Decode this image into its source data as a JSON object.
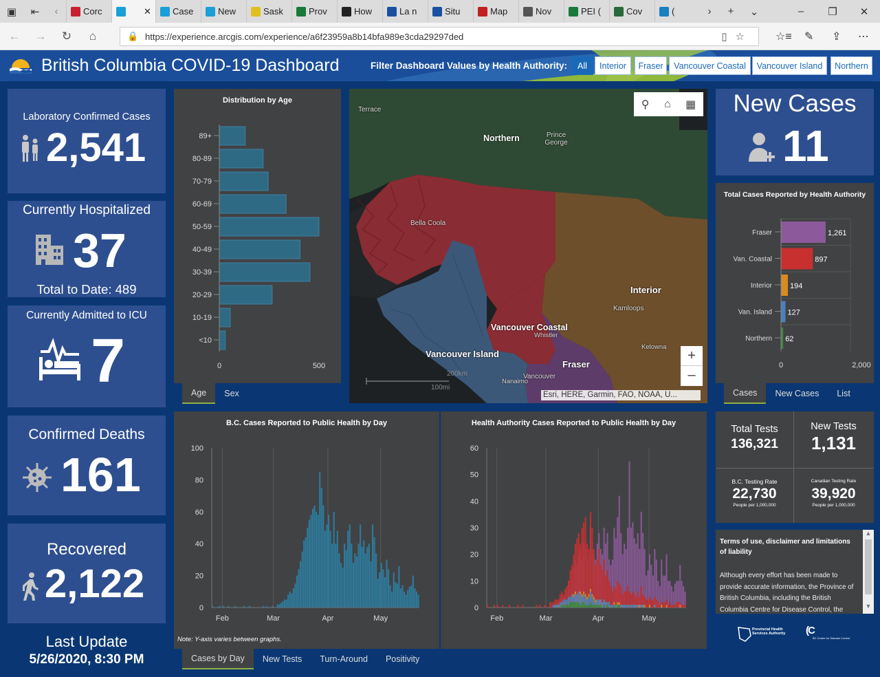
{
  "browser": {
    "tabs": [
      {
        "label": "Corc",
        "color": "#c8202e"
      },
      {
        "label": "",
        "color": "#1a9fd6",
        "active": true
      },
      {
        "label": "Case",
        "color": "#1a9fd6"
      },
      {
        "label": "New",
        "color": "#1a9fd6"
      },
      {
        "label": "Sask",
        "color": "#e0c020"
      },
      {
        "label": "Prov",
        "color": "#1a7a3a"
      },
      {
        "label": "How",
        "color": "#222222"
      },
      {
        "label": "La n",
        "color": "#1a50a0"
      },
      {
        "label": "Situ",
        "color": "#1a50a0"
      },
      {
        "label": "Map",
        "color": "#c02020"
      },
      {
        "label": "Nov",
        "color": "#555555"
      },
      {
        "label": "PEI (",
        "color": "#1a7a3a"
      },
      {
        "label": "Cov",
        "color": "#2a6a3a"
      },
      {
        "label": "(",
        "color": "#1a80c0"
      }
    ],
    "url": "https://experience.arcgis.com/experience/a6f23959a8b14bfa989e3cda29297ded"
  },
  "header": {
    "title": "British Columbia COVID-19 Dashboard",
    "filter_label": "Filter Dashboard Values by Health Authority:",
    "filters": [
      "All",
      "Interior",
      "Fraser",
      "Vancouver Coastal",
      "Vancouver Island",
      "Northern"
    ]
  },
  "kpis": {
    "lab_confirmed": {
      "label": "Laboratory Confirmed Cases",
      "value": "2,541"
    },
    "hospitalized": {
      "label": "Currently Hospitalized",
      "value": "37",
      "sub": "Total to Date: 489"
    },
    "icu": {
      "label": "Currently Admitted to ICU",
      "value": "7"
    },
    "deaths": {
      "label": "Confirmed Deaths",
      "value": "161"
    },
    "recovered": {
      "label": "Recovered",
      "value": "2,122"
    },
    "new_cases": {
      "label": "New Cases",
      "value": "11"
    }
  },
  "last_update": {
    "label": "Last Update",
    "value": "5/26/2020, 8:30 PM"
  },
  "age_chart": {
    "title": "Distribution by Age",
    "tabs": [
      "Age",
      "Sex"
    ],
    "chart_data": {
      "type": "bar",
      "orientation": "horizontal",
      "categories": [
        "89+",
        "80-89",
        "70-79",
        "60-69",
        "50-59",
        "40-49",
        "30-39",
        "20-29",
        "10-19",
        "<10"
      ],
      "values": [
        130,
        220,
        245,
        335,
        500,
        405,
        455,
        265,
        55,
        30
      ],
      "xlim": [
        0,
        500
      ],
      "xticks": [
        "0",
        "500"
      ]
    }
  },
  "map": {
    "labels": [
      "Terrace",
      "Northern",
      "Prince George",
      "Bella Coola",
      "Interior",
      "Kamloops",
      "Vancouver Coastal",
      "Whistler",
      "Kelowna",
      "Vancouver Island",
      "Fraser",
      "Nanaimo",
      "Vancouver"
    ],
    "scale": [
      "200km",
      "100mi"
    ],
    "attribution": "Esri, HERE, Garmin, FAO, NOAA, U...",
    "region_colors": {
      "Northern": "#2e4a33",
      "Interior": "#6e4f2c",
      "Vancouver Coastal": "#8a2c33",
      "Vancouver Island": "#3c5878",
      "Fraser": "#5e3c6a"
    }
  },
  "ha_chart": {
    "title": "Total Cases Reported by Health Authority",
    "tabs": [
      "Cases",
      "New Cases",
      "List"
    ],
    "chart_data": {
      "type": "bar",
      "orientation": "horizontal",
      "categories": [
        "Fraser",
        "Van. Coastal",
        "Interior",
        "Van. Island",
        "Northern"
      ],
      "values": [
        1261,
        897,
        194,
        127,
        62
      ],
      "value_labels": [
        "1,261",
        "897",
        "194",
        "127",
        "62"
      ],
      "colors": [
        "#8c5a9a",
        "#c83030",
        "#d98a20",
        "#4a80c0",
        "#3a8a3a"
      ],
      "xlim": [
        0,
        2000
      ],
      "xticks": [
        "0",
        "2,000"
      ]
    }
  },
  "tests": {
    "total": {
      "label": "Total Tests",
      "value": "136,321"
    },
    "new": {
      "label": "New Tests",
      "value": "1,131"
    },
    "bc_rate": {
      "label": "B.C. Testing Rate",
      "value": "22,730",
      "sub": "People per 1,000,000"
    },
    "ca_rate": {
      "label": "Canadian Testing Rate",
      "value": "39,920",
      "sub": "People per 1,000,000"
    }
  },
  "disclaimer": {
    "title": "Terms of use, disclaimer and limitations of liability",
    "body": "Although every effort has been made to provide accurate information, the Province of British Columbia, including the British Columbia Centre for Disease Control, the"
  },
  "footer_logos": [
    "Provincial Health Services Authority",
    "BC Centre for Disease Control"
  ],
  "bc_daily": {
    "title": "B.C. Cases Reported to Public Health by Day",
    "note": "Note: Y-axis varies between graphs.",
    "tabs": [
      "Cases by Day",
      "New Tests",
      "Turn-Around",
      "Positivity"
    ],
    "chart_data": {
      "type": "bar",
      "color": "#2d7fa3",
      "yticks": [
        "0",
        "20",
        "40",
        "60",
        "80",
        "100"
      ],
      "ylim": [
        0,
        100
      ],
      "xticks": [
        "Feb",
        "Mar",
        "Apr",
        "May"
      ],
      "x_start": "2020-01-26",
      "values": [
        1,
        0,
        0,
        0,
        1,
        0,
        1,
        0,
        0,
        1,
        0,
        0,
        0,
        1,
        0,
        0,
        0,
        0,
        1,
        0,
        0,
        1,
        0,
        0,
        0,
        0,
        0,
        0,
        0,
        1,
        0,
        1,
        0,
        0,
        1,
        0,
        0,
        2,
        2,
        3,
        4,
        5,
        5,
        8,
        10,
        9,
        12,
        15,
        20,
        24,
        29,
        35,
        42,
        44,
        50,
        55,
        58,
        62,
        64,
        60,
        58,
        85,
        75,
        64,
        48,
        52,
        58,
        48,
        40,
        60,
        40,
        48,
        34,
        28,
        25,
        40,
        36,
        48,
        52,
        40,
        28,
        34,
        32,
        40,
        52,
        38,
        42,
        34,
        38,
        40,
        29,
        52,
        44,
        34,
        18,
        22,
        28,
        24,
        19,
        30,
        24,
        14,
        10,
        22,
        16,
        15,
        26,
        12,
        14,
        10,
        8,
        11,
        13,
        14,
        20,
        12,
        10,
        8
      ]
    }
  },
  "ha_daily": {
    "title": "Health Authority Cases Reported to Public Health by Day",
    "chart_data": {
      "type": "bar",
      "stacked": false,
      "yticks": [
        "0",
        "10",
        "20",
        "30",
        "40",
        "50",
        "60"
      ],
      "ylim": [
        0,
        60
      ],
      "xticks": [
        "Feb",
        "Mar",
        "Apr",
        "May"
      ],
      "x_start": "2020-01-26",
      "series": [
        {
          "name": "Fraser",
          "color": "#8c5a9a",
          "values": [
            0,
            0,
            0,
            0,
            0,
            0,
            0,
            0,
            0,
            0,
            0,
            0,
            0,
            0,
            0,
            0,
            0,
            0,
            0,
            0,
            0,
            0,
            0,
            0,
            0,
            0,
            0,
            0,
            0,
            0,
            0,
            0,
            0,
            0,
            0,
            0,
            0,
            0,
            0,
            1,
            1,
            2,
            2,
            3,
            4,
            4,
            5,
            8,
            10,
            10,
            14,
            15,
            18,
            16,
            20,
            22,
            18,
            24,
            22,
            18,
            20,
            30,
            22,
            20,
            18,
            24,
            28,
            22,
            20,
            30,
            24,
            28,
            18,
            16,
            18,
            30,
            26,
            34,
            42,
            28,
            20,
            24,
            22,
            30,
            55,
            30,
            32,
            26,
            24,
            28,
            22,
            36,
            28,
            22,
            12,
            14,
            20,
            16,
            12,
            22,
            18,
            10,
            8,
            18,
            12,
            12,
            20,
            10,
            10,
            8,
            6,
            9,
            10,
            10,
            16,
            10,
            8,
            6
          ]
        },
        {
          "name": "Van. Coastal",
          "color": "#c83030",
          "values": [
            1,
            0,
            0,
            0,
            1,
            0,
            1,
            0,
            0,
            1,
            0,
            0,
            0,
            1,
            0,
            0,
            0,
            0,
            1,
            0,
            0,
            1,
            0,
            0,
            0,
            0,
            0,
            0,
            0,
            1,
            0,
            1,
            0,
            0,
            1,
            0,
            0,
            2,
            2,
            2,
            3,
            3,
            3,
            5,
            6,
            5,
            7,
            8,
            10,
            14,
            16,
            20,
            24,
            26,
            28,
            24,
            30,
            32,
            34,
            24,
            22,
            36,
            30,
            22,
            16,
            18,
            22,
            16,
            14,
            18,
            12,
            14,
            10,
            8,
            6,
            8,
            7,
            10,
            9,
            8,
            5,
            6,
            6,
            8,
            6,
            5,
            6,
            5,
            4,
            6,
            4,
            8,
            5,
            4,
            3,
            3,
            4,
            3,
            3,
            4,
            3,
            2,
            1,
            2,
            2,
            2,
            3,
            1,
            2,
            1,
            1,
            1,
            2,
            2,
            2,
            1,
            1,
            1
          ]
        },
        {
          "name": "Interior",
          "color": "#d98a20",
          "values": [
            0,
            0,
            0,
            0,
            0,
            0,
            0,
            0,
            0,
            0,
            0,
            0,
            0,
            0,
            0,
            0,
            0,
            0,
            0,
            0,
            0,
            0,
            0,
            0,
            0,
            0,
            0,
            0,
            0,
            0,
            0,
            0,
            0,
            0,
            0,
            0,
            0,
            0,
            0,
            0,
            1,
            1,
            1,
            1,
            2,
            2,
            2,
            3,
            4,
            4,
            5,
            5,
            6,
            5,
            6,
            6,
            5,
            6,
            5,
            4,
            5,
            7,
            5,
            4,
            3,
            3,
            3,
            3,
            2,
            3,
            2,
            2,
            2,
            1,
            1,
            2,
            1,
            2,
            2,
            1,
            1,
            1,
            1,
            1,
            1,
            1,
            1,
            1,
            1,
            1,
            1,
            1,
            1,
            1,
            0,
            0,
            1,
            0,
            0,
            1,
            0,
            0,
            0,
            1,
            0,
            0,
            1,
            0,
            0,
            0,
            0,
            0,
            0,
            0,
            1,
            0,
            0,
            0
          ]
        },
        {
          "name": "Van. Island",
          "color": "#4a80c0",
          "values": [
            0,
            0,
            0,
            0,
            0,
            0,
            0,
            0,
            0,
            0,
            0,
            0,
            0,
            0,
            0,
            0,
            0,
            0,
            0,
            0,
            0,
            0,
            0,
            0,
            0,
            0,
            0,
            0,
            0,
            0,
            0,
            0,
            0,
            0,
            0,
            0,
            0,
            0,
            0,
            1,
            1,
            1,
            1,
            2,
            2,
            3,
            3,
            3,
            4,
            4,
            5,
            4,
            5,
            5,
            6,
            5,
            4,
            5,
            4,
            3,
            4,
            6,
            4,
            3,
            2,
            3,
            3,
            3,
            2,
            3,
            2,
            2,
            2,
            1,
            1,
            1,
            1,
            1,
            1,
            1,
            1,
            1,
            1,
            1,
            1,
            1,
            1,
            1,
            1,
            1,
            0,
            1,
            1,
            0,
            0,
            0,
            0,
            0,
            0,
            1,
            0,
            0,
            0,
            0,
            0,
            0,
            0,
            0,
            0,
            0,
            0,
            0,
            0,
            0,
            0,
            0,
            0,
            0
          ]
        },
        {
          "name": "Northern",
          "color": "#3a8a3a",
          "values": [
            0,
            0,
            0,
            0,
            0,
            0,
            0,
            0,
            0,
            0,
            0,
            0,
            0,
            0,
            0,
            0,
            0,
            0,
            0,
            0,
            0,
            0,
            0,
            0,
            0,
            0,
            0,
            0,
            0,
            0,
            0,
            0,
            0,
            0,
            0,
            0,
            0,
            0,
            0,
            0,
            0,
            0,
            0,
            0,
            1,
            1,
            1,
            1,
            1,
            2,
            2,
            2,
            2,
            2,
            2,
            1,
            2,
            2,
            1,
            1,
            1,
            2,
            1,
            1,
            1,
            1,
            1,
            1,
            0,
            1,
            0,
            1,
            0,
            0,
            0,
            1,
            0,
            1,
            1,
            0,
            0,
            0,
            0,
            0,
            0,
            0,
            0,
            0,
            0,
            0,
            0,
            0,
            0,
            0,
            0,
            0,
            0,
            0,
            0,
            0,
            0,
            0,
            0,
            0,
            0,
            0,
            0,
            0,
            0,
            0,
            0,
            0,
            0,
            0,
            0,
            0,
            0,
            0
          ]
        }
      ]
    }
  }
}
